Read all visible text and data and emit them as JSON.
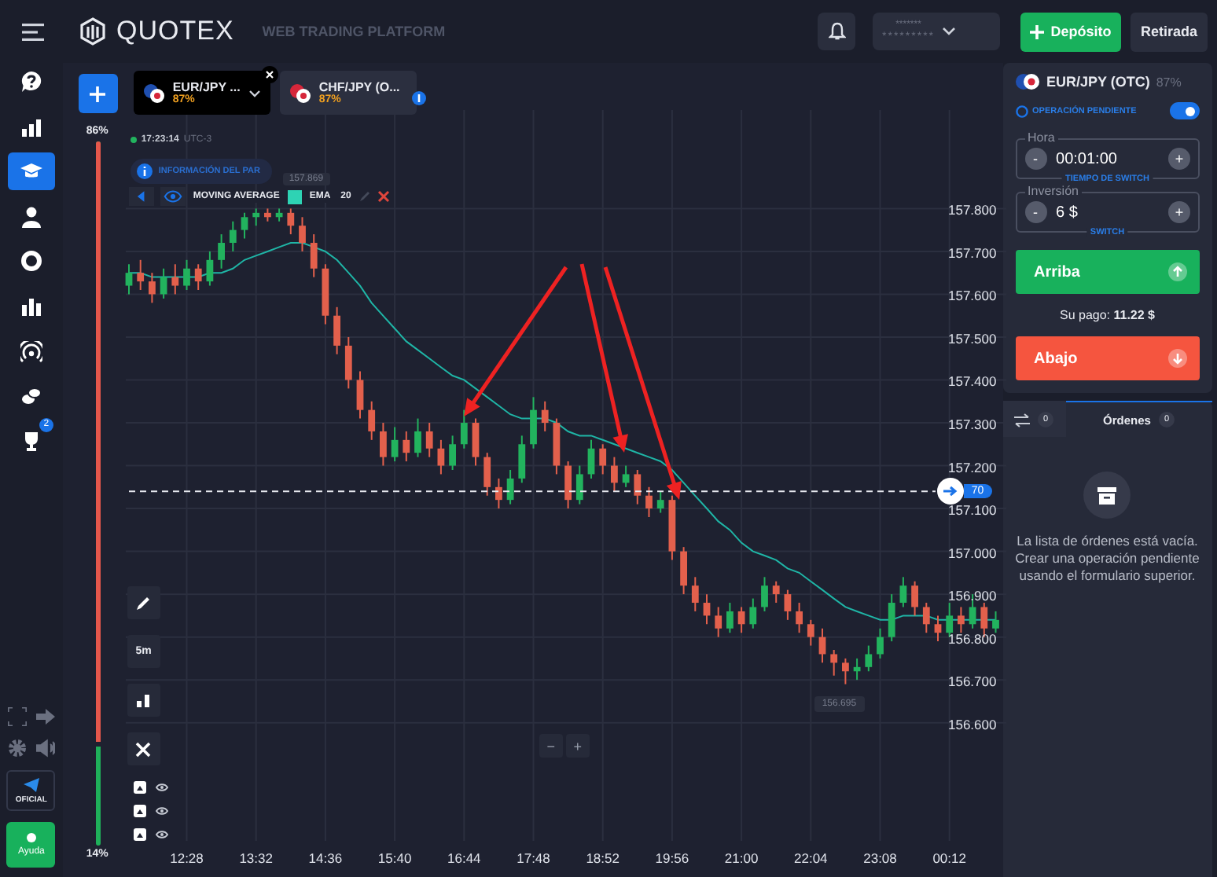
{
  "header": {
    "logo": "QUOTEX",
    "subtitle": "WEB TRADING PLATFORM",
    "account": {
      "line_1": "*******",
      "line_2": "*********"
    },
    "deposit_button": "Depósito",
    "withdraw_button": "Retirada"
  },
  "sidebar": {
    "items": [
      {
        "selected": false
      },
      {
        "selected": false
      },
      {
        "selected": true
      },
      {
        "selected": false
      },
      {
        "selected": false
      },
      {
        "selected": false
      },
      {
        "selected": false
      },
      {
        "selected": false
      },
      {
        "selected": false,
        "badge": "2"
      }
    ],
    "official_label": "OFICIAL",
    "help_label": "Ayuda"
  },
  "asset_tabs": [
    {
      "name": "EUR/JPY ...",
      "payout": "87%",
      "selected": true
    },
    {
      "name": "CHF/JPY (O...",
      "payout": "87%",
      "selected": false
    }
  ],
  "sentiment": {
    "level": 0.86,
    "top_label": "86%",
    "bottom_label": "14%"
  },
  "chart": {
    "clock": "17:23:14",
    "timezone": "UTC-3",
    "info_pill": "INFORMACIÓN DEL PAR",
    "indicator": {
      "name": "MOVING AVERAGE"
    },
    "high_label": "157.869",
    "low_label": "156.695",
    "current_price": "70",
    "timeframe": "5m",
    "zoom_out": "−",
    "zoom_in": "+",
    "chart_data": {
      "type": "candlestick",
      "categories": [
        null,
        null,
        null,
        null,
        null,
        "12:28",
        null,
        null,
        null,
        null,
        null,
        "13:32",
        null,
        null,
        null,
        null,
        null,
        "14:36",
        null,
        null,
        null,
        null,
        null,
        "15:40",
        null,
        null,
        null,
        null,
        null,
        "16:44",
        null,
        null,
        null,
        null,
        null,
        "17:48",
        null,
        null,
        null,
        null,
        null,
        "18:52",
        null,
        null,
        null,
        null,
        null,
        "19:56",
        null,
        null,
        null,
        null,
        null,
        "21:00",
        null,
        null,
        null,
        null,
        null,
        "22:04",
        null,
        null,
        null,
        null,
        null,
        "23:08",
        null,
        null,
        null,
        null,
        null,
        "00:12",
        null,
        null,
        null,
        null
      ],
      "ohlc": [
        [
          157.62,
          157.67,
          157.6,
          157.65
        ],
        [
          157.65,
          157.68,
          157.61,
          157.63
        ],
        [
          157.63,
          157.65,
          157.58,
          157.6
        ],
        [
          157.6,
          157.66,
          157.59,
          157.64
        ],
        [
          157.64,
          157.67,
          157.6,
          157.62
        ],
        [
          157.62,
          157.68,
          157.61,
          157.66
        ],
        [
          157.66,
          157.67,
          157.61,
          157.63
        ],
        [
          157.63,
          157.7,
          157.62,
          157.68
        ],
        [
          157.68,
          157.74,
          157.66,
          157.72
        ],
        [
          157.72,
          157.77,
          157.7,
          157.75
        ],
        [
          157.75,
          157.79,
          157.73,
          157.78
        ],
        [
          157.78,
          157.8,
          157.76,
          157.79
        ],
        [
          157.79,
          157.8,
          157.77,
          157.78
        ],
        [
          157.78,
          157.8,
          157.77,
          157.79
        ],
        [
          157.79,
          157.8,
          157.74,
          157.76
        ],
        [
          157.76,
          157.78,
          157.7,
          157.72
        ],
        [
          157.72,
          157.74,
          157.64,
          157.66
        ],
        [
          157.66,
          157.67,
          157.53,
          157.55
        ],
        [
          157.55,
          157.57,
          157.46,
          157.48
        ],
        [
          157.48,
          157.5,
          157.38,
          157.4
        ],
        [
          157.4,
          157.42,
          157.31,
          157.33
        ],
        [
          157.33,
          157.35,
          157.26,
          157.28
        ],
        [
          157.28,
          157.3,
          157.2,
          157.22
        ],
        [
          157.22,
          157.29,
          157.21,
          157.26
        ],
        [
          157.26,
          157.28,
          157.21,
          157.23
        ],
        [
          157.23,
          157.31,
          157.22,
          157.28
        ],
        [
          157.28,
          157.3,
          157.22,
          157.24
        ],
        [
          157.24,
          157.26,
          157.18,
          157.2
        ],
        [
          157.2,
          157.27,
          157.19,
          157.25
        ],
        [
          157.25,
          157.33,
          157.24,
          157.3
        ],
        [
          157.3,
          157.31,
          157.2,
          157.22
        ],
        [
          157.22,
          157.23,
          157.13,
          157.15
        ],
        [
          157.15,
          157.17,
          157.1,
          157.12
        ],
        [
          157.12,
          157.19,
          157.11,
          157.17
        ],
        [
          157.17,
          157.27,
          157.16,
          157.25
        ],
        [
          157.25,
          157.36,
          157.24,
          157.33
        ],
        [
          157.33,
          157.35,
          157.28,
          157.3
        ],
        [
          157.3,
          157.31,
          157.18,
          157.2
        ],
        [
          157.2,
          157.21,
          157.1,
          157.12
        ],
        [
          157.12,
          157.2,
          157.11,
          157.18
        ],
        [
          157.18,
          157.26,
          157.17,
          157.24
        ],
        [
          157.24,
          157.25,
          157.18,
          157.2
        ],
        [
          157.2,
          157.22,
          157.14,
          157.16
        ],
        [
          157.16,
          157.2,
          157.15,
          157.18
        ],
        [
          157.18,
          157.19,
          157.11,
          157.13
        ],
        [
          157.13,
          157.15,
          157.08,
          157.1
        ],
        [
          157.1,
          157.14,
          157.09,
          157.12
        ],
        [
          157.12,
          157.13,
          156.98,
          157.0
        ],
        [
          157.0,
          157.01,
          156.9,
          156.92
        ],
        [
          156.92,
          156.94,
          156.86,
          156.88
        ],
        [
          156.88,
          156.9,
          156.83,
          156.85
        ],
        [
          156.85,
          156.87,
          156.8,
          156.82
        ],
        [
          156.82,
          156.88,
          156.81,
          156.86
        ],
        [
          156.86,
          156.87,
          156.81,
          156.83
        ],
        [
          156.83,
          156.89,
          156.82,
          156.87
        ],
        [
          156.87,
          156.94,
          156.86,
          156.92
        ],
        [
          156.92,
          156.93,
          156.88,
          156.9
        ],
        [
          156.9,
          156.91,
          156.84,
          156.86
        ],
        [
          156.86,
          156.88,
          156.81,
          156.83
        ],
        [
          156.83,
          156.84,
          156.78,
          156.8
        ],
        [
          156.8,
          156.82,
          156.74,
          156.76
        ],
        [
          156.76,
          156.77,
          156.71,
          156.74
        ],
        [
          156.74,
          156.75,
          156.69,
          156.72
        ],
        [
          156.72,
          156.75,
          156.7,
          156.73
        ],
        [
          156.73,
          156.78,
          156.72,
          156.76
        ],
        [
          156.76,
          156.82,
          156.75,
          156.8
        ],
        [
          156.8,
          156.9,
          156.79,
          156.88
        ],
        [
          156.88,
          156.94,
          156.87,
          156.92
        ],
        [
          156.92,
          156.93,
          156.85,
          156.87
        ],
        [
          156.87,
          156.88,
          156.81,
          156.83
        ],
        [
          156.83,
          156.85,
          156.79,
          156.81
        ],
        [
          156.81,
          156.88,
          156.8,
          156.85
        ],
        [
          156.85,
          156.87,
          156.81,
          156.83
        ],
        [
          156.83,
          156.9,
          156.82,
          156.87
        ],
        [
          156.87,
          156.88,
          156.8,
          156.82
        ],
        [
          156.82,
          156.86,
          156.81,
          156.84
        ]
      ],
      "series": [
        {
          "name": "EMA 20",
          "type": "line",
          "color": "#1fb5a6",
          "values": [
            157.65,
            157.65,
            157.64,
            157.64,
            157.64,
            157.64,
            157.64,
            157.65,
            157.65,
            157.66,
            157.68,
            157.69,
            157.7,
            157.71,
            157.72,
            157.72,
            157.71,
            157.7,
            157.68,
            157.65,
            157.62,
            157.58,
            157.55,
            157.52,
            157.49,
            157.47,
            157.45,
            157.43,
            157.41,
            157.4,
            157.38,
            157.36,
            157.34,
            157.32,
            157.31,
            157.31,
            157.31,
            157.3,
            157.28,
            157.27,
            157.27,
            157.26,
            157.25,
            157.24,
            157.23,
            157.22,
            157.21,
            157.19,
            157.16,
            157.13,
            157.1,
            157.07,
            157.05,
            157.02,
            157.0,
            156.99,
            156.98,
            156.96,
            156.95,
            156.93,
            156.91,
            156.89,
            156.87,
            156.86,
            156.85,
            156.84,
            156.84,
            156.85,
            156.85,
            156.85,
            156.84,
            156.84,
            156.84,
            156.84,
            156.84,
            156.84
          ]
        }
      ],
      "ref_lines": [
        {
          "axis": "y",
          "value": 157.14
        }
      ],
      "grid": true,
      "ylim": [
        156.24,
        158.14
      ],
      "yticks": [
        {
          "value": 157.8,
          "label": "157.800"
        },
        {
          "value": 157.7,
          "label": "157.700"
        },
        {
          "value": 157.6,
          "label": "157.600"
        },
        {
          "value": 157.5,
          "label": "157.500"
        },
        {
          "value": 157.4,
          "label": "157.400"
        },
        {
          "value": 157.3,
          "label": "157.300"
        },
        {
          "value": 157.2,
          "label": "157.200"
        },
        {
          "value": 157.1,
          "label": "157.100"
        },
        {
          "value": 157.0,
          "label": "157.000"
        },
        {
          "value": 156.9,
          "label": "156.900"
        },
        {
          "value": 156.8,
          "label": "156.800"
        },
        {
          "value": 156.7,
          "label": "156.700"
        },
        {
          "value": 156.6,
          "label": "156.600"
        }
      ]
    }
  },
  "trade_panel": {
    "asset": "EUR/JPY (OTC)",
    "payout": "87%",
    "pending_label": "OPERACIÓN PENDIENTE",
    "pending_on": true,
    "time_field": {
      "label": "Hora",
      "value": "00:01:00",
      "caption": "TIEMPO DE SWITCH",
      "minus": "-",
      "plus": "+"
    },
    "investment_field": {
      "label": "Inversión",
      "value": "6 $",
      "caption": "SWITCH",
      "minus": "-",
      "plus": "+"
    },
    "up_button": "Arriba",
    "payout_text": "Su pago: **11.22 $**",
    "down_button": "Abajo"
  },
  "orders": {
    "tabs": [
      {
        "kind": "trades",
        "count": "0",
        "selected": false
      },
      {
        "kind": "orders",
        "label": "Órdenes",
        "count": "0",
        "selected": true
      }
    ],
    "empty_message": "La lista de órdenes está vacía.",
    "empty_hint": "Crear una operación pendiente usando el formulario superior."
  }
}
